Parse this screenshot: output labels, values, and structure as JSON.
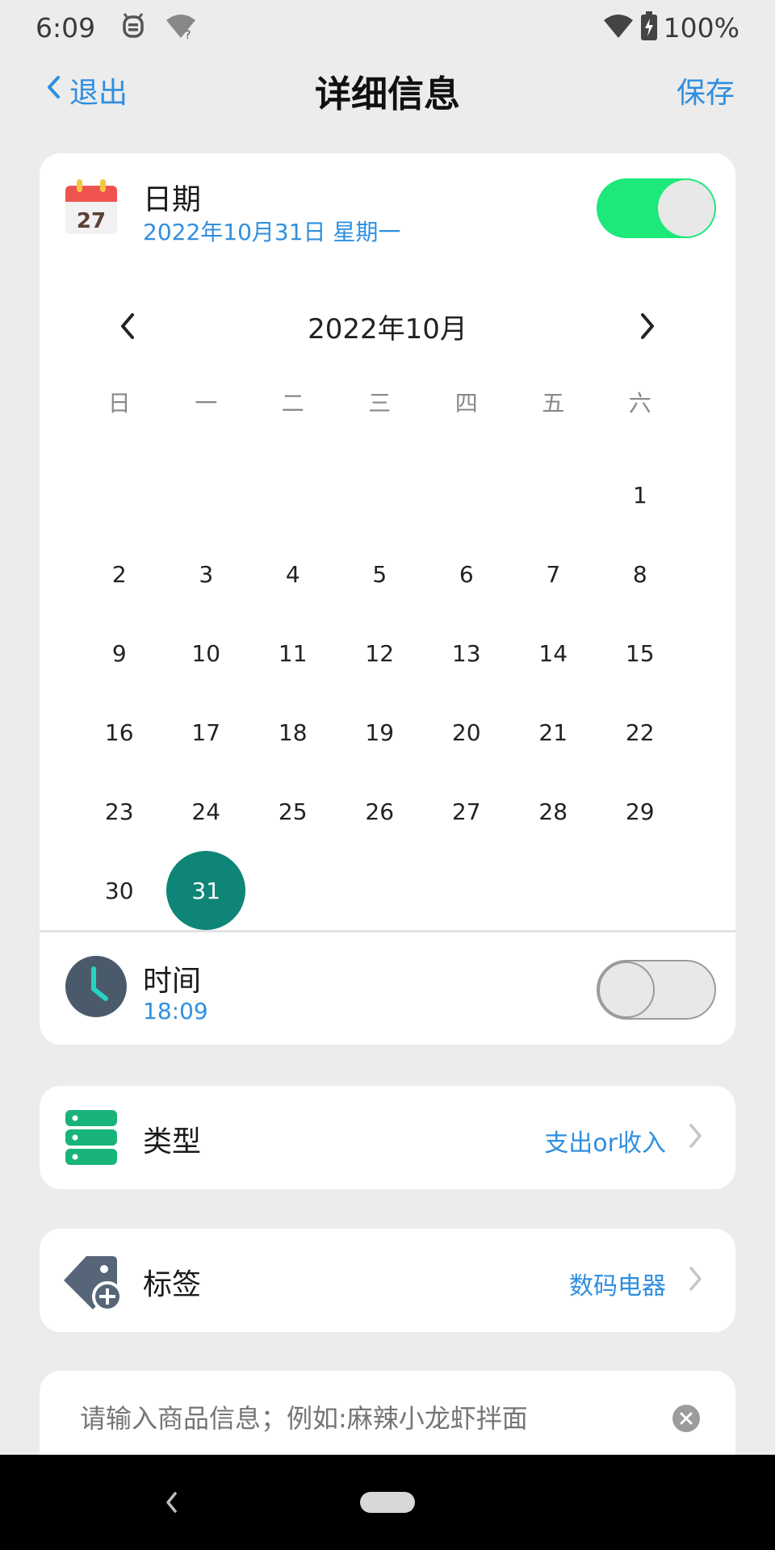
{
  "status_bar": {
    "time": "6:09",
    "battery_text": "100%"
  },
  "nav": {
    "back_label": "退出",
    "title": "详细信息",
    "save_label": "保存"
  },
  "date_row": {
    "icon_day": "27",
    "title": "日期",
    "value": "2022年10月31日 星期一",
    "toggle_on": true
  },
  "calendar": {
    "month_label": "2022年10月",
    "weekdays": [
      "日",
      "一",
      "二",
      "三",
      "四",
      "五",
      "六"
    ],
    "weeks": [
      [
        "",
        "",
        "",
        "",
        "",
        "",
        "1"
      ],
      [
        "2",
        "3",
        "4",
        "5",
        "6",
        "7",
        "8"
      ],
      [
        "9",
        "10",
        "11",
        "12",
        "13",
        "14",
        "15"
      ],
      [
        "16",
        "17",
        "18",
        "19",
        "20",
        "21",
        "22"
      ],
      [
        "23",
        "24",
        "25",
        "26",
        "27",
        "28",
        "29"
      ],
      [
        "30",
        "31",
        "",
        "",
        "",
        "",
        ""
      ]
    ],
    "selected_day": "31"
  },
  "time_row": {
    "title": "时间",
    "value": "18:09",
    "toggle_on": false
  },
  "type_row": {
    "title": "类型",
    "value": "支出or收入"
  },
  "tag_row": {
    "title": "标签",
    "value": "数码电器"
  },
  "product_input": {
    "placeholder": "请输入商品信息；例如:麻辣小龙虾拌面"
  },
  "colors": {
    "accent": "#2f8fe0",
    "toggle_on": "#1de87a",
    "selected_day": "#0e8577"
  }
}
